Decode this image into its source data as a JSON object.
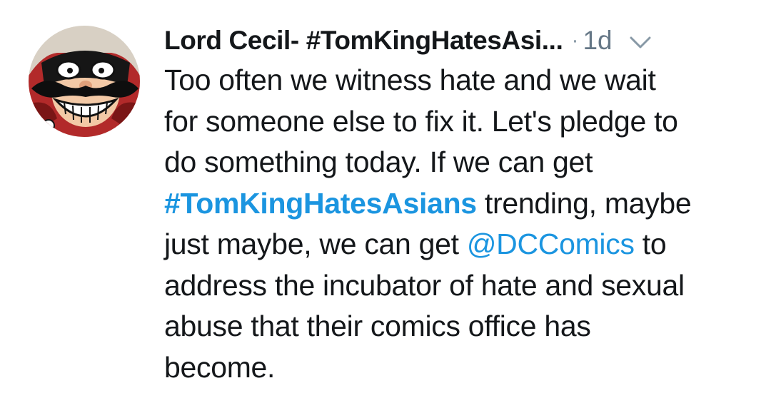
{
  "tweet": {
    "display_name": "Lord Cecil- #TomKingHatesAsi...",
    "separator": "·",
    "timestamp": "1d",
    "body": {
      "line1": "Too often we witness hate and we wait",
      "line2": "for someone else to fix it. Let's pledge to",
      "line3": "do something today. If we can get",
      "line4_hashtag": "#TomKingHatesAsians",
      "line4_rest": " trending, maybe",
      "line5_pre": "just maybe, we can get ",
      "line5_mention": "@DCComics",
      "line5_post": " to",
      "line6": "address the incubator of hate and sexual",
      "line7": "abuse that their comics office has",
      "line8": "become."
    }
  },
  "icons": {
    "avatar": "cartoon-mask-face-avatar",
    "menu": "chevron-down-icon"
  },
  "colors": {
    "link": "#1b95e0",
    "text": "#14171a",
    "muted": "#657786"
  }
}
